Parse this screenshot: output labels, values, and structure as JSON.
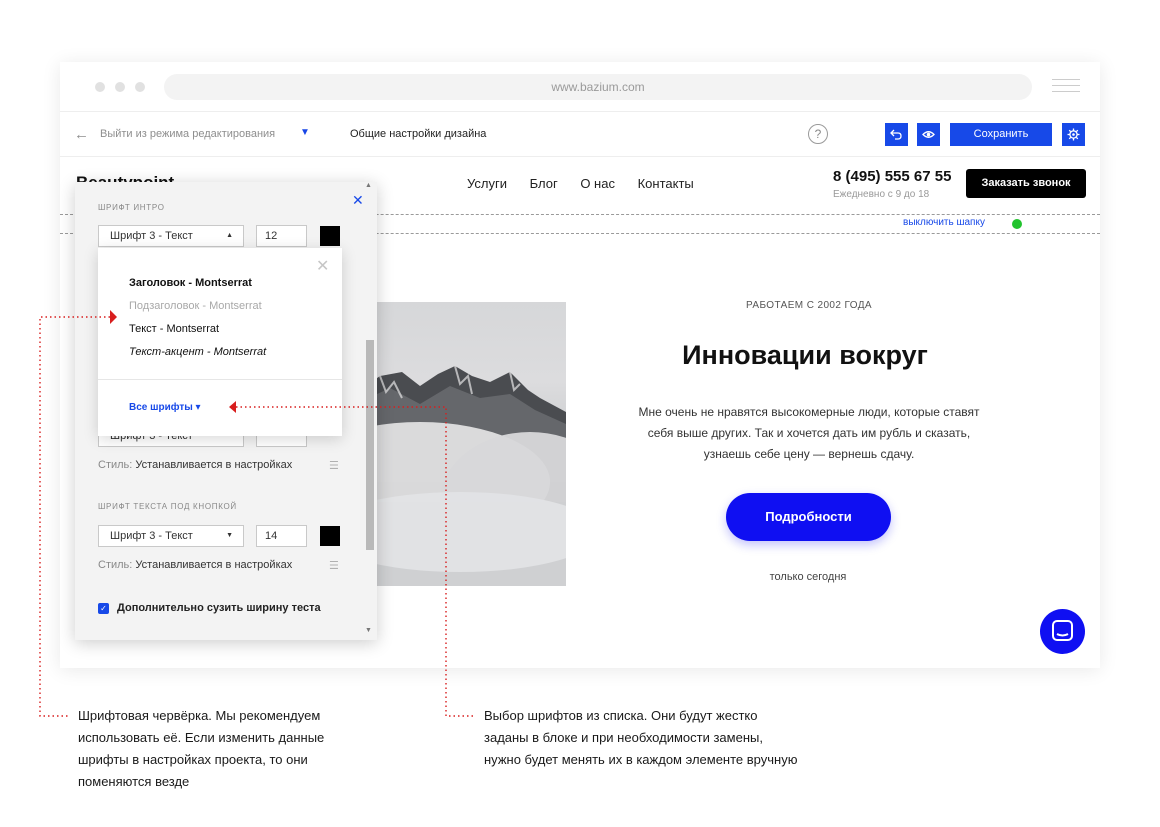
{
  "colors": {
    "accent": "#1749e8",
    "hero_button": "#0f0ff2",
    "annotation": "#d81e1e",
    "status_dot": "#22c32e"
  },
  "browser": {
    "url": "www.bazium.com"
  },
  "editor_toolbar": {
    "back_icon": "arrow-left-icon",
    "exit_label": "Выйти из режима редактирования",
    "design_label": "Общие настройки дизайна",
    "help_label": "?",
    "save_label": "Сохранить"
  },
  "site": {
    "logo": "Beautypoint",
    "nav": [
      "Услуги",
      "Блог",
      "О нас",
      "Контакты"
    ],
    "phone": "8 (495) 555 67 55",
    "hours": "Ежедневно с 9 до 18",
    "call_button": "Заказать звонок",
    "header_toggle": "выключить шапку",
    "hero": {
      "kicker": "РАБОТАЕМ С 2002 ГОДА",
      "title": "Инновации вокруг",
      "text": "Мне очень не нравятся высокомерные люди, которые ставят себя выше других. Так и хочется дать им рубль и сказать, узнаешь себе цену — вернешь сдачу.",
      "button": "Подробности",
      "note": "только сегодня"
    }
  },
  "panel": {
    "section1_title": "шрифт интро",
    "section1_font": "Шрифт 3 - Текст",
    "section1_size": "12",
    "hidden_font": "Шрифт 3 - Текст",
    "style_label": "Стиль:",
    "style_value": "Устанавливается в настройках",
    "section2_title": "шрифт текста под кнопкой",
    "section2_font": "Шрифт 3 - Текст",
    "section2_size": "14",
    "checkbox_label": "Дополнительно сузить ширину теста"
  },
  "font_dropdown": {
    "options": [
      {
        "label": "Заголовок - Montserrat"
      },
      {
        "label": "Подзаголовок - Montserrat"
      },
      {
        "label": "Текст - Montserrat"
      },
      {
        "label": "Текст-акцент - Montserrat"
      }
    ],
    "all_fonts": "Все шрифты"
  },
  "annotations": {
    "left": [
      "Шрифтовая червёрка. Мы рекомендуем",
      "использовать её. Если изменить данные",
      "шрифты в настройках проекта, то они",
      "поменяются везде"
    ],
    "right": [
      "Выбор шрифтов из списка. Они будут жестко",
      "заданы в блоке и при необходимости замены,",
      "нужно будет менять их в каждом элементе вручную"
    ]
  }
}
